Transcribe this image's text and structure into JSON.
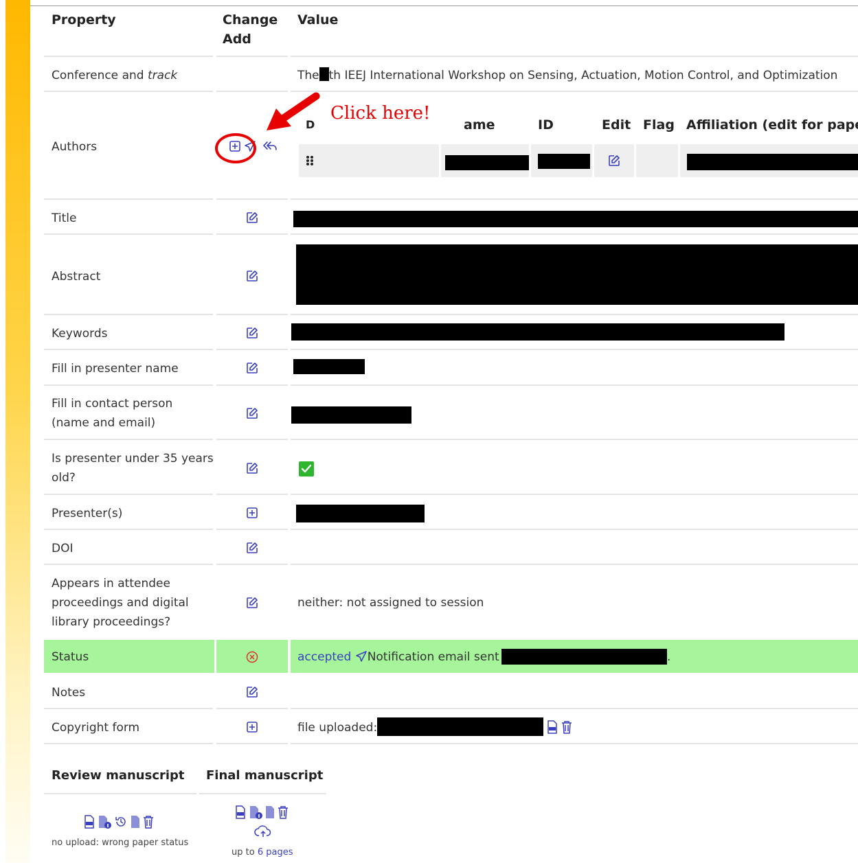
{
  "table": {
    "headers": {
      "property": "Property",
      "change_add": "Change\nAdd",
      "value": "Value"
    },
    "rows": {
      "conference": {
        "label_a": "Conference",
        "label_b": "and",
        "label_c": "track",
        "value_pre": "The",
        "value_post": "th IEEJ International Workshop on Sensing, Actuation, Motion Control, and Optimization"
      },
      "authors": {
        "label": "Authors"
      },
      "title": {
        "label": "Title"
      },
      "abstract": {
        "label": "Abstract"
      },
      "keywords": {
        "label": "Keywords"
      },
      "presenter_name": {
        "label": "Fill in presenter name"
      },
      "contact": {
        "label": "Fill in contact person\n(name and email)"
      },
      "under35": {
        "label": "Is presenter under 35 years\nold?"
      },
      "presenters": {
        "label": "Presenter(s)"
      },
      "doi": {
        "label": "DOI"
      },
      "proceedings": {
        "label": "Appears in attendee\nproceedings and digital\nlibrary proceedings?",
        "value": "neither: not assigned to session"
      },
      "status": {
        "label": "Status",
        "value_link": "accepted",
        "value_text": "Notification email sent",
        "value_end": "."
      },
      "notes": {
        "label": "Notes"
      },
      "copyright": {
        "label": "Copyright form",
        "value": "file uploaded:"
      }
    }
  },
  "authors_table": {
    "headers": [
      "D",
      "ame",
      "ID",
      "Edit",
      "Flag",
      "Affiliation (edit for paper"
    ]
  },
  "annotation": {
    "text": "Click here!"
  },
  "manuscripts": {
    "review_title": "Review manuscript",
    "final_title": "Final manuscript",
    "review_note": "no upload: wrong paper status",
    "final_note_pre": "up to",
    "final_note_num": "6 pages"
  },
  "colors": {
    "accent": "#3a3fbf",
    "status_bg": "#a6f59a",
    "annotation": "#e60000",
    "sidebar": "#ffb800"
  }
}
